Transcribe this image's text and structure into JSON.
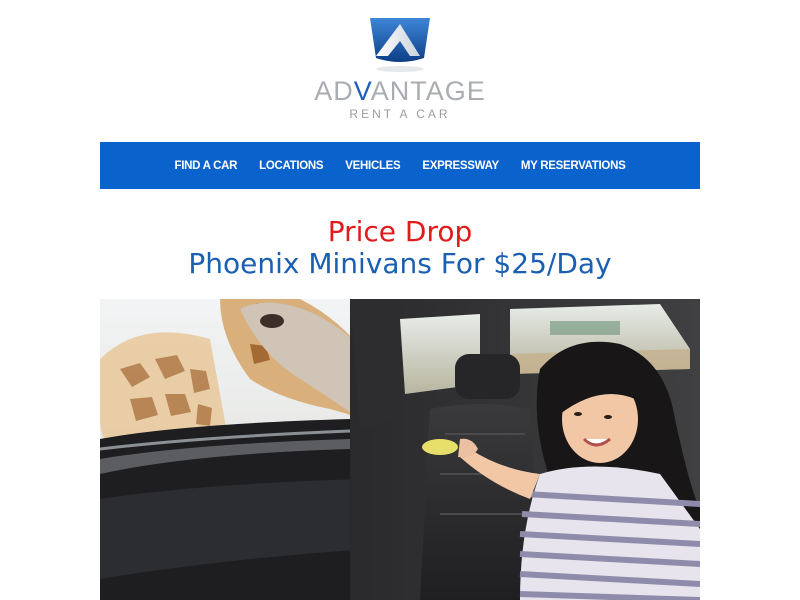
{
  "brand": {
    "wordmark_start": "AD",
    "wordmark_accent": "V",
    "wordmark_end": "ANTAGE",
    "tagline": "RENT A CAR",
    "colors": {
      "emblem_blue": "#1c5fb8",
      "wordmark_gray": "#a9adb2"
    }
  },
  "nav": {
    "background": "#0a62cc",
    "items": [
      {
        "label": "FIND A CAR"
      },
      {
        "label": "LOCATIONS"
      },
      {
        "label": "VEHICLES"
      },
      {
        "label": "EXPRESSWAY"
      },
      {
        "label": "MY RESERVATIONS"
      }
    ]
  },
  "headline": {
    "line1": "Price Drop",
    "line2": "Phoenix Minivans For $25/Day",
    "line1_color": "#e01b1b",
    "line2_color": "#1b5fb0"
  },
  "hero": {
    "icon": "giraffe-feeding-photo"
  }
}
